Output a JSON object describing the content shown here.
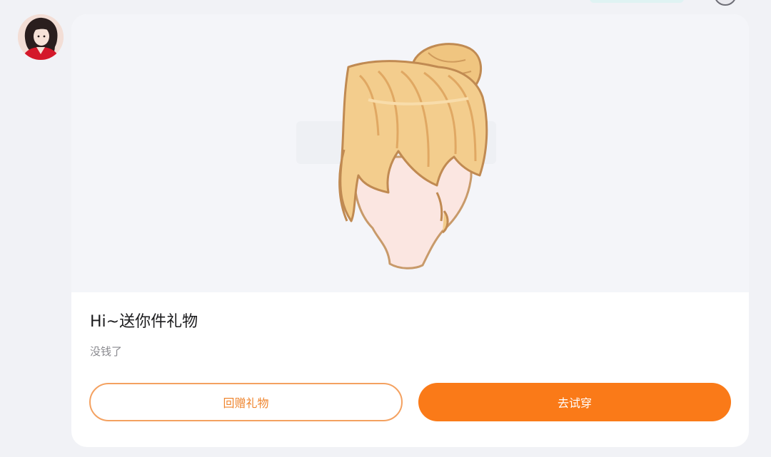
{
  "message": {
    "sender_avatar": "user-avatar-photo",
    "card": {
      "image_icon": "hair-bun-item-icon",
      "title": "Hi~送你件礼物",
      "subtitle": "没钱了",
      "buttons": {
        "return_gift": "回赠礼物",
        "try_on": "去试穿"
      }
    }
  },
  "colors": {
    "accent": "#fa7a18",
    "accent_outline": "#f4a160",
    "card_background": "#ffffff",
    "page_background": "#f1f2f6"
  }
}
